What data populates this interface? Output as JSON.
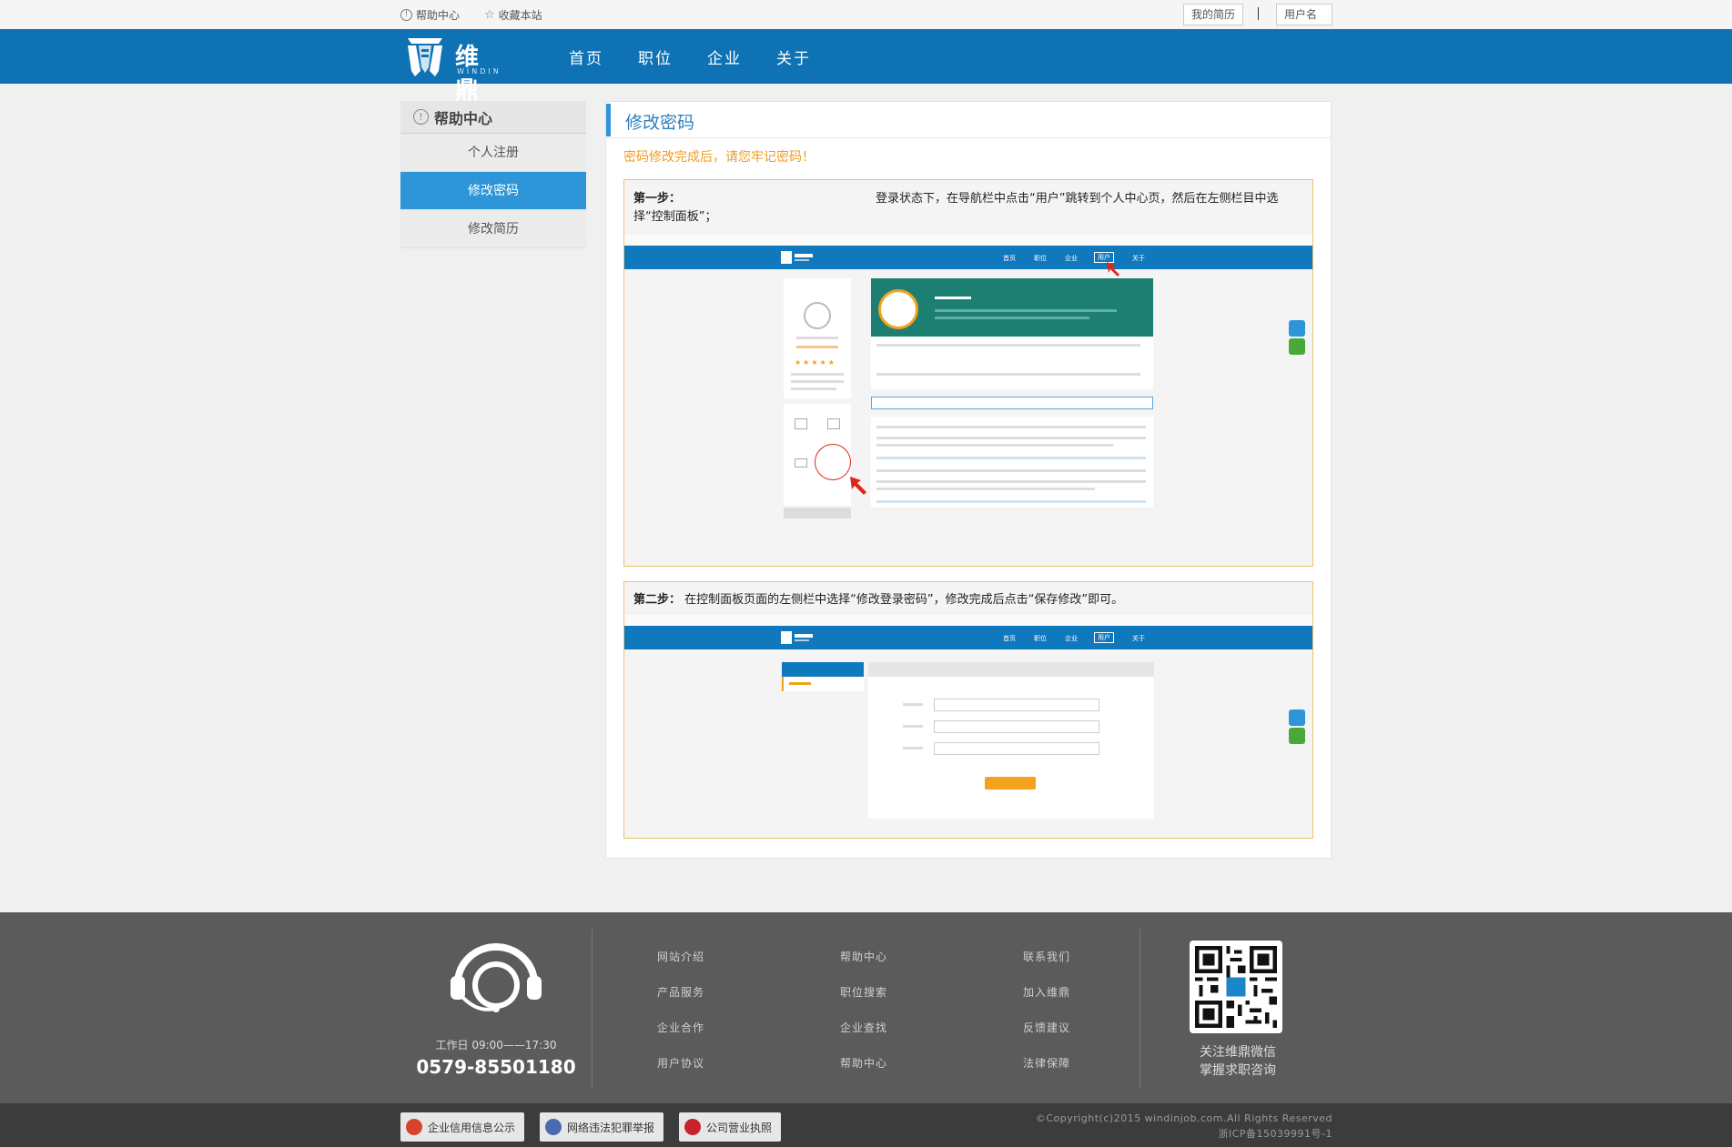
{
  "topbar": {
    "help": "帮助中心",
    "favorite": "收藏本站",
    "my_resume": "我的简历",
    "separator": "|",
    "username": "用户名∨"
  },
  "nav": {
    "logo_cn": "维鼎",
    "logo_en": "WINDIN",
    "items": [
      "首页",
      "职位",
      "企业",
      "关于"
    ]
  },
  "sidebar": {
    "title": "帮助中心",
    "items": [
      "个人注册",
      "修改密码",
      "修改简历"
    ],
    "active_index": 1
  },
  "main": {
    "title": "修改密码",
    "notice": "密码修改完成后，请您牢记密码！",
    "step1": {
      "label": "第一步：",
      "text": "登录状态下，在导航栏中点击“用户”跳转到个人中心页，然后在左侧栏目中选择“控制面板”；"
    },
    "step2": {
      "label": "第二步：",
      "text": "在控制面板页面的左侧栏中选择“修改登录密码”，修改完成后点击“保存修改”即可。"
    }
  },
  "screenshot_nav": [
    "首页",
    "职位",
    "企业",
    "用户",
    "关于"
  ],
  "footer": {
    "worktime": "工作日  09:00——17:30",
    "phone": "0579-85501180",
    "links": [
      [
        "网站介绍",
        "产品服务",
        "企业合作",
        "用户协议"
      ],
      [
        "帮助中心",
        "职位搜索",
        "企业查找",
        "帮助中心"
      ],
      [
        "联系我们",
        "加入维鼎",
        "反馈建议",
        "法律保障"
      ]
    ],
    "qr_text_1": "关注维鼎微信",
    "qr_text_2": "掌握求职咨询"
  },
  "bottom": {
    "badges": [
      "企业信用信息公示",
      "网络违法犯罪举报",
      "公司营业执照"
    ],
    "copyright": "©Copyright(c)2015 windinjob.com.All Rights Reserved",
    "icp": "浙ICP备15039991号-1"
  },
  "colors": {
    "nav_blue": "#0e72b5",
    "active_blue": "#2d95d8",
    "notice_orange": "#f19b24",
    "footer_gray": "#5b5b5b"
  }
}
